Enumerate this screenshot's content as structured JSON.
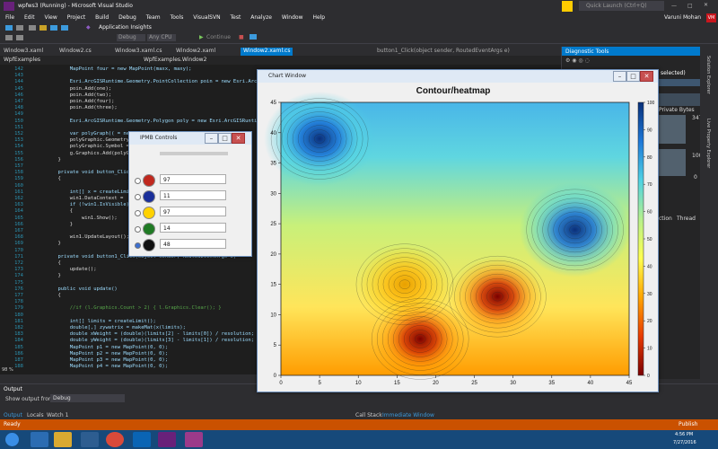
{
  "window": {
    "title": "wpfws3 (Running) - Microsoft Visual Studio",
    "quick_launch": "Quick Launch (Ctrl+Q)",
    "user": "Varuni Mohan",
    "user_initials": "VM"
  },
  "menu": [
    "File",
    "Edit",
    "View",
    "Project",
    "Build",
    "Debug",
    "Team",
    "Tools",
    "VisualSVN",
    "Test",
    "Analyze",
    "Window",
    "Help"
  ],
  "toolbar": {
    "config": "Debug",
    "platform": "Any CPU",
    "continue": "Continue",
    "app_insights": "Application Insights"
  },
  "tabs": [
    "Window3.xaml",
    "Window2.cs",
    "Window3.xaml.cs",
    "Window2.xaml",
    "Window2.xaml.cs",
    "button1_Click(object sender, RoutedEventArgs e)"
  ],
  "navbar": {
    "project": "WpfExamples",
    "class": "WpfExamples.Window2"
  },
  "editor": {
    "line_numbers": [
      "142",
      "143",
      "144",
      "145",
      "146",
      "147",
      "148",
      "149",
      "150",
      "151",
      "152",
      "153",
      "154",
      "155",
      "156",
      "157",
      "158",
      "159",
      "160",
      "161",
      "162",
      "163",
      "164",
      "165",
      "166",
      "167",
      "168",
      "169",
      "170",
      "171",
      "172",
      "173",
      "174",
      "175",
      "176",
      "177",
      "178",
      "179",
      "180",
      "181",
      "182",
      "183",
      "184",
      "185",
      "186",
      "187",
      "188"
    ],
    "lines": [
      "            MapPoint four = new MapPoint(maxx, maxy);",
      "",
      "            Esri.ArcGISRuntime.Geometry.PointCollection poin = new Esri.ArcGIS",
      "            poin.Add(one);",
      "            poin.Add(two);",
      "            poin.Add(four);",
      "            poin.Add(three);",
      "",
      "            Esri.ArcGISRuntime.Geometry.Polygon poly = new Esri.ArcGISRuntime.G",
      "",
      "            var polyGraph(( = new",
      "            polyGraphic.Geometry",
      "            polyGraphic.Symbol =",
      "            g.Graphics.Add(polyGraph",
      "        }",
      "",
      "        private void button_Click(",
      "        {",
      "",
      "            int[] x = createLimit",
      "            win1.DataContext = ",
      "            if (!win1.IsVisible)",
      "            {",
      "                win1.Show();",
      "            }",
      "",
      "            win1.UpdateLayout();",
      "        }",
      "",
      "        private void button1_Click(object sender, RoutedEventArgs e)",
      "        {",
      "            update();",
      "        }",
      "",
      "        public void update()",
      "        {",
      "",
      "            //if (l.Graphics.Count > 2) { l.Graphics.Clear(); }",
      "",
      "            int[] limits = createLimit();",
      "            double[,] zywatrix = makeMat(x(limits);",
      "            double xWeight = (double)(limits[2] - limits[0]) / resolution;",
      "            double yWeight = (double)(limits[3] - limits[1]) / resolution;",
      "            MapPoint p1 = new MapPoint(0, 0);",
      "            MapPoint p2 = new MapPoint(0, 0);",
      "            MapPoint p3 = new MapPoint(0, 0);",
      "            MapPoint p4 = new MapPoint(0, 0);"
    ],
    "zoom": "98 %"
  },
  "diagnostic": {
    "title": "Diagnostic Tools",
    "selected": "selected)",
    "private_bytes": "Private Bytes",
    "val_347": "347",
    "val_100": "100",
    "val_0": "0",
    "tab_action": "ction",
    "tab_thread": "Thread"
  },
  "right_strip": [
    "Solution Explorer",
    "Live Property Explorer"
  ],
  "ipmb": {
    "title": "IPMB Controls",
    "items": [
      {
        "value": "97",
        "color": "#c0281e"
      },
      {
        "value": "11",
        "color": "#1a2f9a"
      },
      {
        "value": "97",
        "color": "#ffd200"
      },
      {
        "value": "14",
        "color": "#1f7a24"
      },
      {
        "value": "48",
        "color": "#101010"
      }
    ]
  },
  "chart_window": {
    "title": "Chart Window"
  },
  "chart_data": {
    "type": "heatmap",
    "title": "Contour/heatmap",
    "xlabel": "",
    "ylabel": "",
    "xlim": [
      0,
      45
    ],
    "ylim": [
      0,
      45
    ],
    "x_ticks": [
      0,
      5,
      10,
      15,
      20,
      25,
      30,
      35,
      40,
      45
    ],
    "y_ticks": [
      0,
      5,
      10,
      15,
      20,
      25,
      30,
      35,
      40,
      45
    ],
    "colorbar": {
      "range": [
        0,
        100
      ],
      "ticks": [
        0,
        10,
        20,
        30,
        40,
        50,
        60,
        70,
        80,
        90,
        100
      ],
      "colors": [
        "#7b0000",
        "#e83a00",
        "#ffa500",
        "#ffff50",
        "#b6f08c",
        "#4fd2e4",
        "#1e78d8",
        "#08307a"
      ]
    },
    "hotspots": [
      {
        "x": 5,
        "y": 39,
        "value": 100
      },
      {
        "x": 38,
        "y": 24,
        "value": 92
      },
      {
        "x": 16,
        "y": 15,
        "value": 45
      },
      {
        "x": 28,
        "y": 13,
        "value": 8
      },
      {
        "x": 18,
        "y": 6,
        "value": 2
      }
    ],
    "grid": false
  },
  "output": {
    "title": "Output",
    "show_label": "Show output from:",
    "show_value": "Debug",
    "bottom_tabs": [
      "Output",
      "Locals",
      "Watch 1"
    ],
    "right_tabs": [
      "Call Stack",
      "Immediate Window"
    ]
  },
  "status": {
    "left": "Ready",
    "publish": "Publish"
  },
  "taskbar": {
    "time": "4:56 PM",
    "date": "7/27/2016"
  }
}
